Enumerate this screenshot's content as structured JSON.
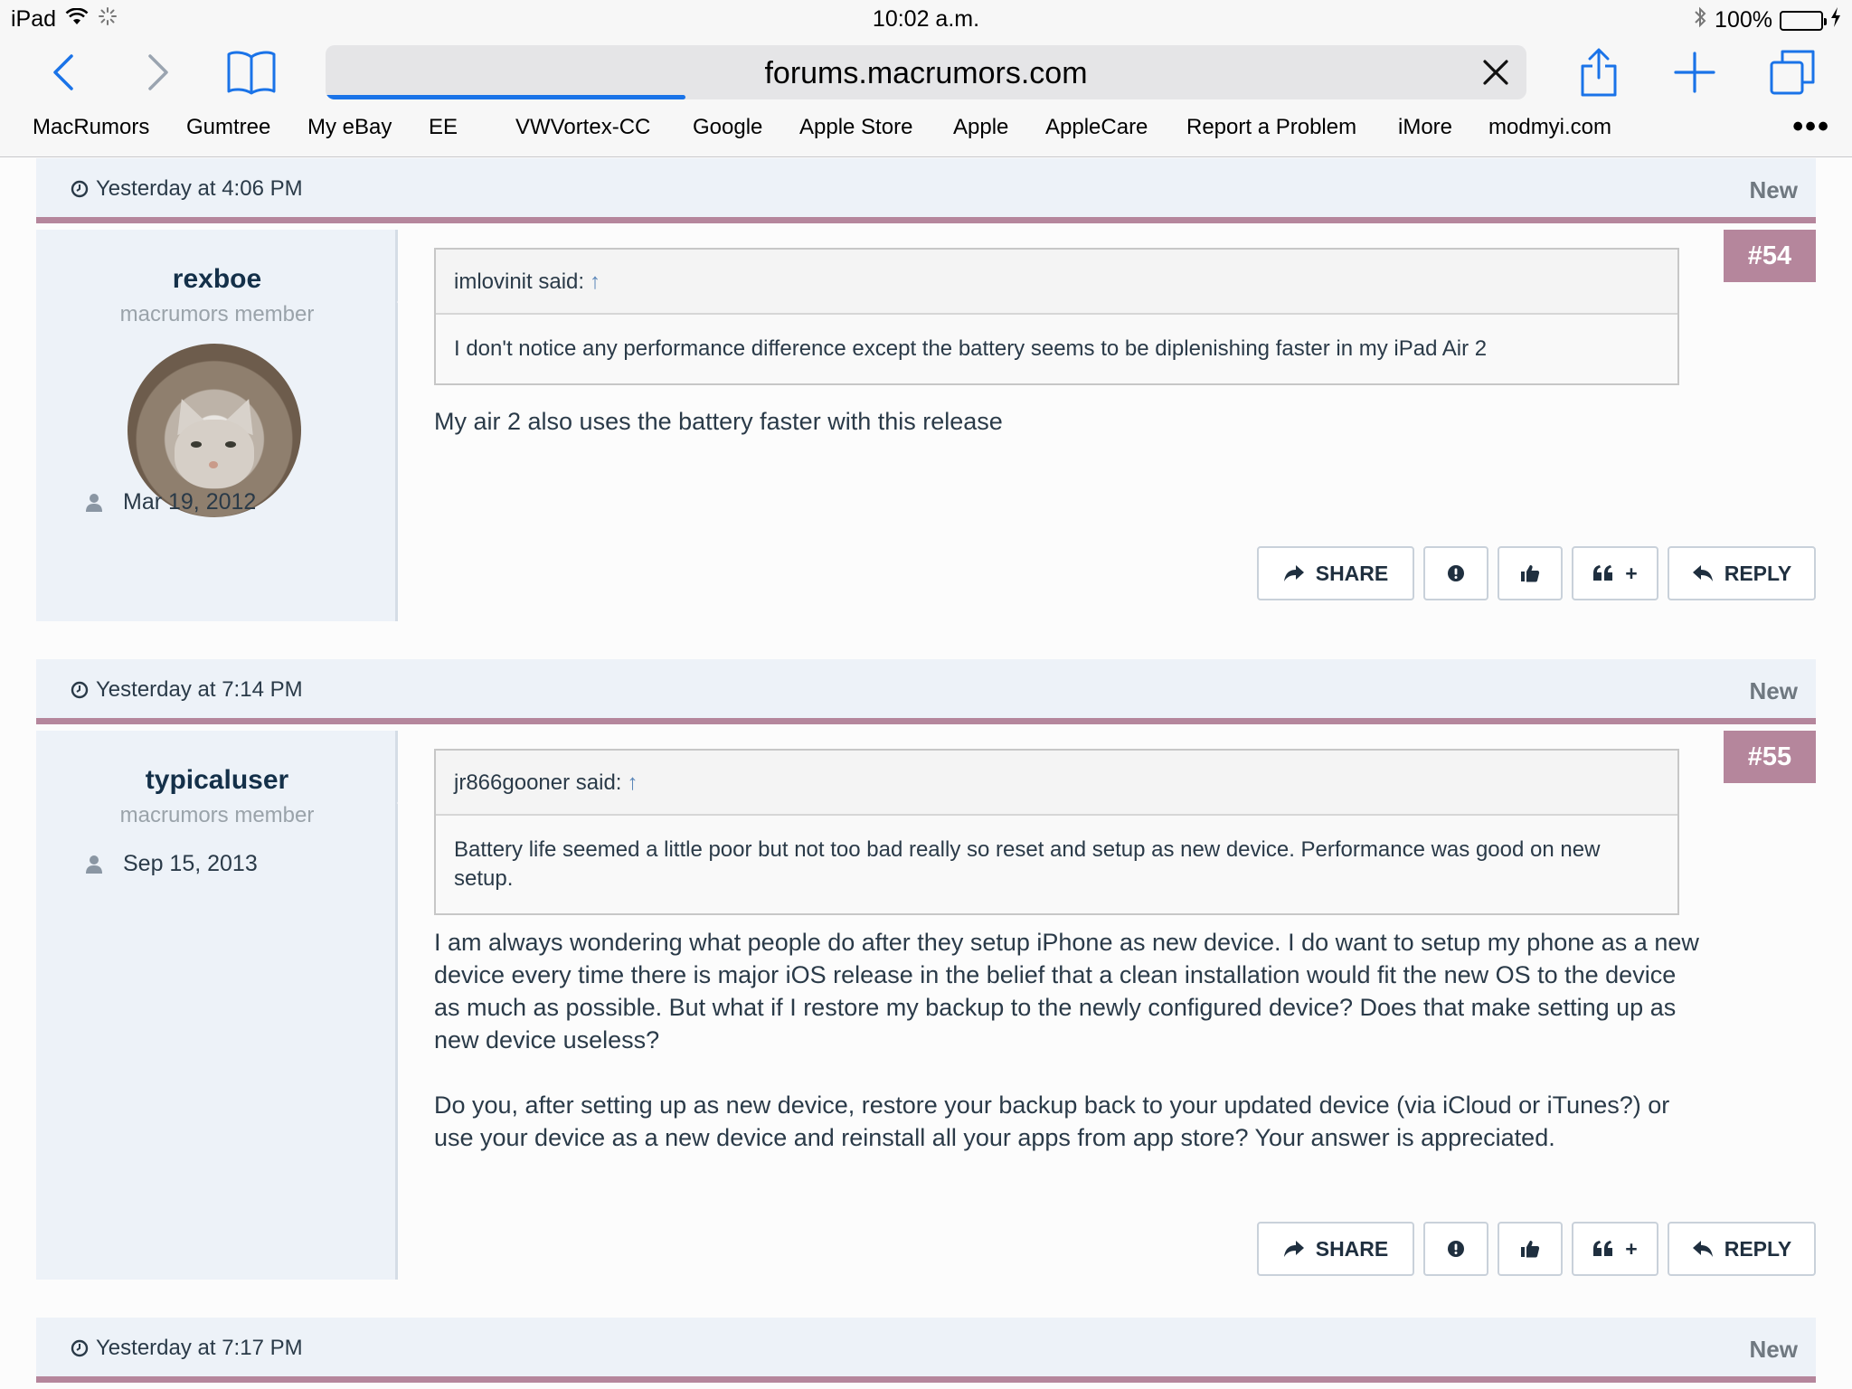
{
  "status_bar": {
    "device": "iPad",
    "time": "10:02 a.m.",
    "battery": "100%"
  },
  "browser": {
    "url": "forums.macrumors.com",
    "load_progress": 0.3,
    "bookmarks": [
      "MacRumors",
      "Gumtree",
      "My eBay",
      "EE",
      "VWVortex-CC",
      "Google",
      "Apple Store",
      "Apple",
      "AppleCare",
      "Report a Problem",
      "iMore",
      "modmyi.com"
    ],
    "more_label": "•••"
  },
  "posts": [
    {
      "time": "Yesterday at 4:06 PM",
      "new_label": "New",
      "number": "#54",
      "username": "rexboe",
      "user_title": "macrumors member",
      "joined": "Mar 19, 2012",
      "quote_author": "imlovinit said:",
      "quote_text": "I don't notice any performance difference except the battery seems to be diplenishing faster in my iPad Air 2",
      "message": [
        "My air 2 also uses the battery faster with this release"
      ]
    },
    {
      "time": "Yesterday at 7:14 PM",
      "new_label": "New",
      "number": "#55",
      "username": "typicaluser",
      "user_title": "macrumors member",
      "joined": "Sep 15, 2013",
      "quote_author": "jr866gooner said:",
      "quote_text": "Battery life seemed a little poor but not too bad really so reset and setup as new device. Performance was good on new setup.",
      "message": [
        "I am always wondering what people do after they setup iPhone as new device. I do want to setup my phone as a new device every time there is major iOS release in the belief that a clean installation would fit the new OS to the device as much as possible. But what if I restore my backup to the newly configured device? Does that make setting up as new device useless?",
        "Do you, after setting up as new device, restore your backup back to your updated device (via iCloud or iTunes?) or use your device as a new device and reinstall all your apps from app store? Your answer is appreciated."
      ]
    },
    {
      "time": "Yesterday at 7:17 PM",
      "new_label": "New"
    }
  ],
  "actions": {
    "share": "SHARE",
    "quote_plus": "+",
    "reply": "REPLY"
  },
  "colors": {
    "accent": "#b5869c",
    "header_bg": "#edf2f8",
    "link_blue": "#1a73e8",
    "battery_green": "#4cd964"
  }
}
